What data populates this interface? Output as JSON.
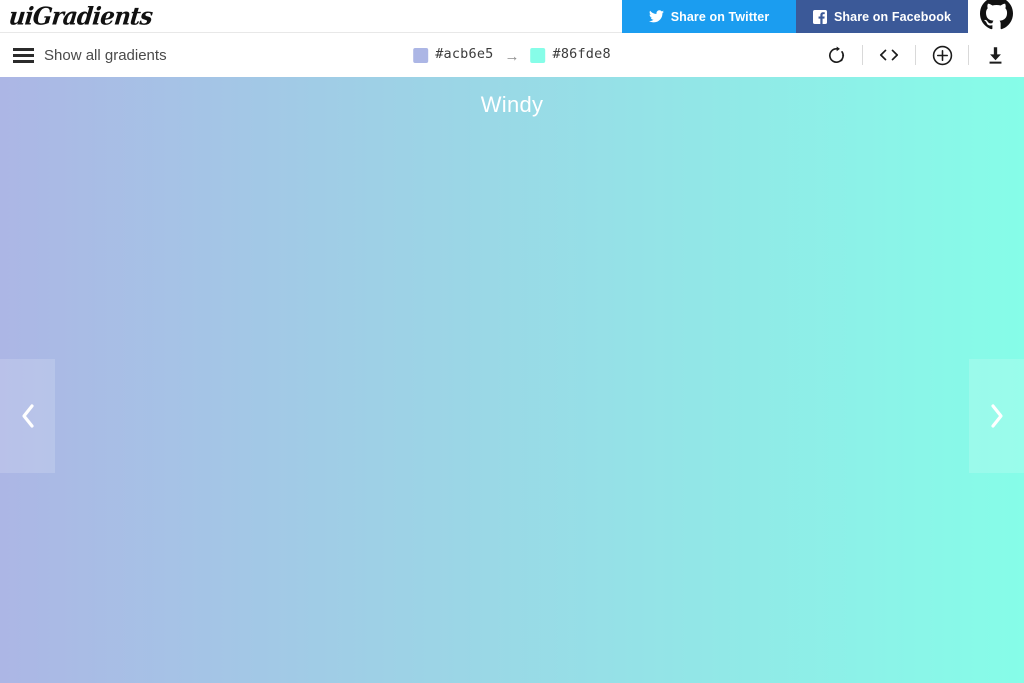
{
  "header": {
    "logo_text": "uiGradients",
    "share_twitter_label": "Share on Twitter",
    "share_facebook_label": "Share on Facebook",
    "twitter_color": "#1b9df0",
    "facebook_color": "#3b5998",
    "github_icon": "github-octocat-icon"
  },
  "toolbar": {
    "show_all_label": "Show all gradients",
    "menu_icon": "hamburger-menu-icon",
    "arrow_separator": "→",
    "color_start": {
      "hex_label": "#acb6e5",
      "hex_value": "#acb6e5"
    },
    "color_end": {
      "hex_label": "#86fde8",
      "hex_value": "#86fde8"
    },
    "tools": [
      {
        "name": "rotate-gradient-icon",
        "title": "Rotate gradient"
      },
      {
        "name": "code-icon",
        "title": "Get CSS code"
      },
      {
        "name": "plus-circle-icon",
        "title": "Add gradient"
      },
      {
        "name": "download-icon",
        "title": "Download"
      }
    ]
  },
  "stage": {
    "gradient_name": "Windy",
    "gradient_css": "linear-gradient(to right, #acb6e5 0%, #86fde8 100%)",
    "prev_icon": "chevron-left-icon",
    "next_icon": "chevron-right-icon"
  }
}
